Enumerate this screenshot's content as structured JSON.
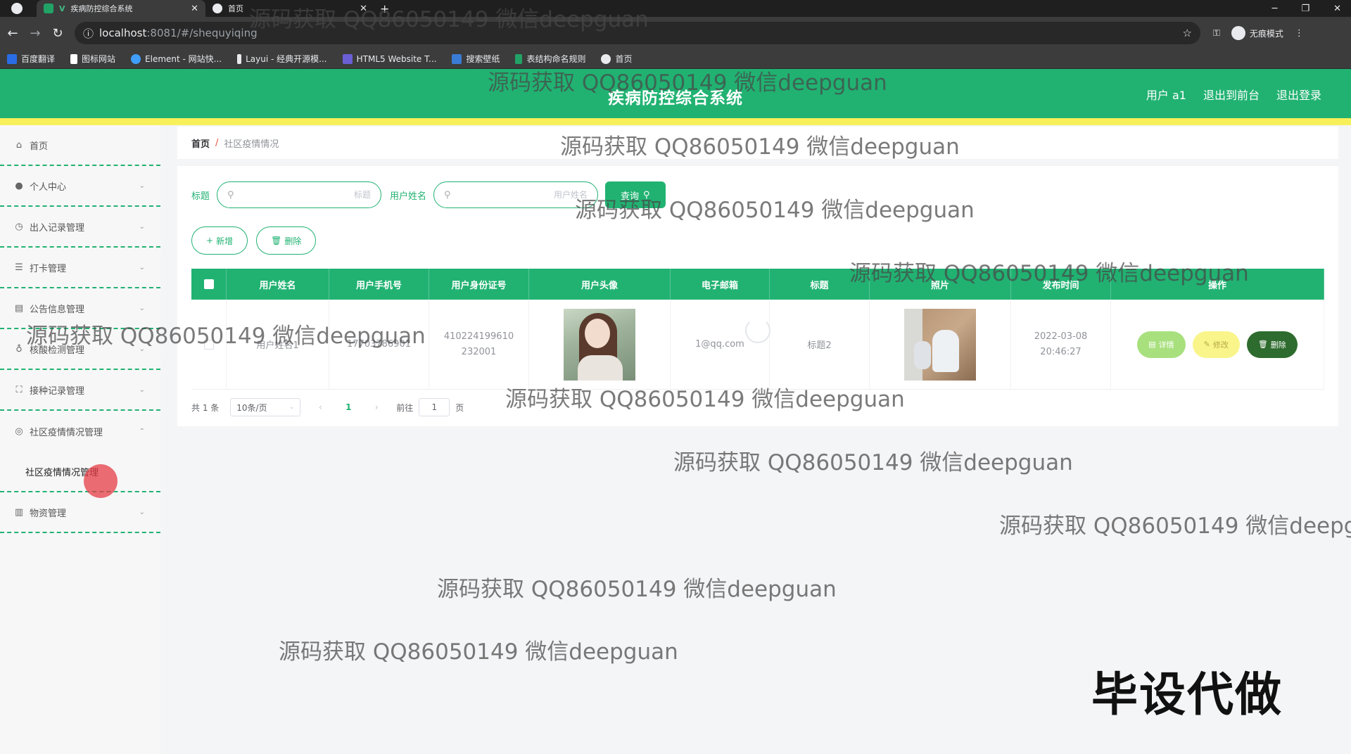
{
  "browser": {
    "tabs": [
      {
        "label": "疾病防控综合系统",
        "active": true
      },
      {
        "label": "首页",
        "active": false
      }
    ],
    "url_host": "localhost",
    "url_rest": ":8081/#/shequyiqing",
    "incognito_label": "无痕模式",
    "bookmarks": [
      {
        "label": "百度翻译",
        "color": "#2a6ce5"
      },
      {
        "label": "图标网站",
        "color": "#ffffff"
      },
      {
        "label": "Element - 网站快...",
        "color": "#409eff"
      },
      {
        "label": "Layui - 经典开源模...",
        "color": "#e8eaed"
      },
      {
        "label": "HTML5 Website T...",
        "color": "#6b5fd6"
      },
      {
        "label": "搜索壁纸",
        "color": "#3a7bd5"
      },
      {
        "label": "表结构命名规则",
        "color": "#21a366"
      },
      {
        "label": "首页",
        "color": "#e8eaed"
      }
    ]
  },
  "header": {
    "title": "疾病防控综合系统",
    "user": "用户 a1",
    "back_to_front": "退出到前台",
    "logout": "退出登录",
    "accent": "#21b272"
  },
  "sidebar": {
    "items": [
      {
        "label": "首页",
        "icon": "home-icon"
      },
      {
        "label": "个人中心",
        "icon": "user-icon"
      },
      {
        "label": "出入记录管理",
        "icon": "clock-icon"
      },
      {
        "label": "打卡管理",
        "icon": "list-icon"
      },
      {
        "label": "公告信息管理",
        "icon": "clipboard-icon"
      },
      {
        "label": "核酸检测管理",
        "icon": "mic-icon"
      },
      {
        "label": "接种记录管理",
        "icon": "scan-icon"
      },
      {
        "label": "社区疫情情况管理",
        "icon": "globe-icon"
      },
      {
        "label": "物资管理",
        "icon": "chart-icon"
      }
    ],
    "active_sub": "社区疫情情况管理"
  },
  "breadcrumb": {
    "home": "首页",
    "separator": "/",
    "current": "社区疫情情况"
  },
  "search": {
    "title_label": "标题",
    "title_placeholder": "标题",
    "username_label": "用户姓名",
    "username_placeholder": "用户姓名",
    "query_button": "查询"
  },
  "actions": {
    "add": "新增",
    "delete": "删除"
  },
  "table": {
    "headers": [
      "用户姓名",
      "用户手机号",
      "用户身份证号",
      "用户头像",
      "电子邮箱",
      "标题",
      "照片",
      "发布时间",
      "操作"
    ],
    "rows": [
      {
        "name": "用户姓名1",
        "phone": "17703786901",
        "id_number": "410224199610232001",
        "email": "1@qq.com",
        "title": "标题2",
        "time": "2022-03-08 20:46:27"
      }
    ],
    "op_detail": "详情",
    "op_edit": "修改",
    "op_delete": "删除"
  },
  "pagination": {
    "total": "共 1 条",
    "page_size": "10条/页",
    "current_page": "1",
    "goto_label": "前往",
    "goto_value": "1",
    "page_suffix": "页"
  },
  "watermark": "源码获取 QQ86050149 微信deepguan",
  "brand_overlay": "毕设代做"
}
